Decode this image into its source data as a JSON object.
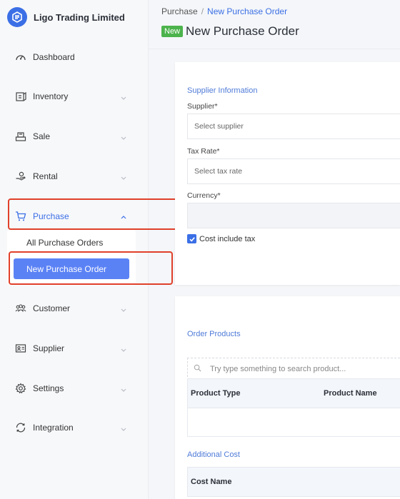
{
  "brand": {
    "name": "Ligo Trading Limited",
    "logo_icon": "ligo-logo-icon"
  },
  "sidebar": {
    "items": [
      {
        "label": "Dashboard",
        "icon": "speedometer-icon"
      },
      {
        "label": "Inventory",
        "icon": "inventory-icon"
      },
      {
        "label": "Sale",
        "icon": "sale-register-icon"
      },
      {
        "label": "Rental",
        "icon": "rental-hand-icon"
      },
      {
        "label": "Purchase",
        "icon": "cart-icon"
      },
      {
        "label": "Customer",
        "icon": "users-icon"
      },
      {
        "label": "Supplier",
        "icon": "id-card-icon"
      },
      {
        "label": "Settings",
        "icon": "gear-icon"
      },
      {
        "label": "Integration",
        "icon": "sync-icon"
      }
    ],
    "purchase_submenu": [
      {
        "label": "All Purchase Orders"
      },
      {
        "label": "New Purchase Order"
      }
    ],
    "active_item": "Purchase",
    "selected_subitem": "New Purchase Order"
  },
  "header": {
    "breadcrumb_parent": "Purchase",
    "breadcrumb_separator": "/",
    "breadcrumb_current": "New Purchase Order",
    "badge": "New",
    "title": "New Purchase Order"
  },
  "supplier_info": {
    "section_title": "Supplier Information",
    "supplier_label": "Supplier*",
    "supplier_placeholder": "Select supplier",
    "tax_label": "Tax Rate*",
    "tax_placeholder": "Select tax rate",
    "currency_label": "Currency*",
    "currency_value": "",
    "cost_include_tax_label": "Cost include tax",
    "cost_include_tax_checked": true
  },
  "order_products": {
    "section_title": "Order Products",
    "search_placeholder": "Try type something to search product...",
    "columns": [
      "Product Type",
      "Product Name"
    ],
    "additional_cost_title": "Additional Cost",
    "additional_cost_columns": [
      "Cost Name"
    ]
  },
  "colors": {
    "accent": "#3b6fe6",
    "selected_bg": "#5b82f5",
    "badge_green": "#4cb34c",
    "highlight_red": "#e0402a"
  }
}
